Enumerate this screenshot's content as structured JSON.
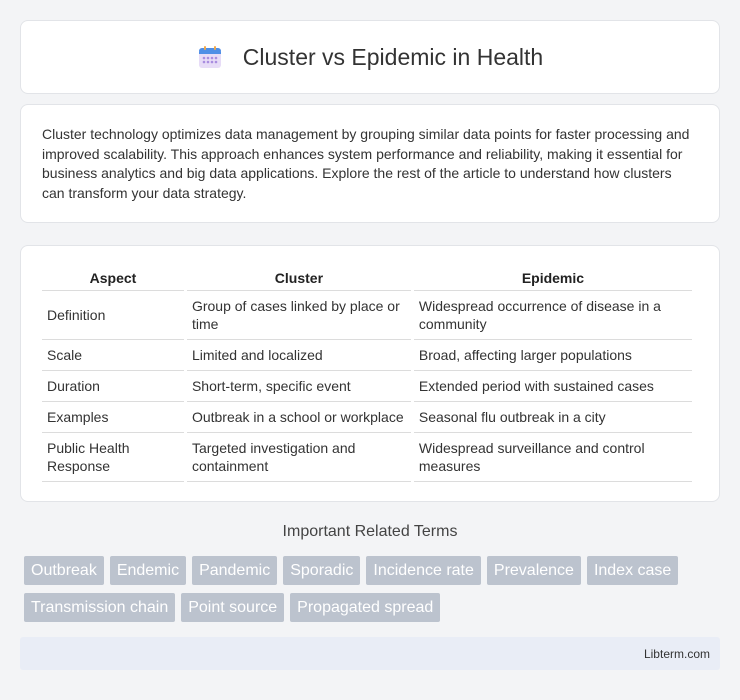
{
  "header": {
    "title": "Cluster vs Epidemic in Health",
    "icon": "calendar-icon"
  },
  "intro": {
    "text": "Cluster technology optimizes data management by grouping similar data points for faster processing and improved scalability. This approach enhances system performance and reliability, making it essential for business analytics and big data applications. Explore the rest of the article to understand how clusters can transform your data strategy."
  },
  "table": {
    "headers": [
      "Aspect",
      "Cluster",
      "Epidemic"
    ],
    "rows": [
      [
        "Definition",
        "Group of cases linked by place or time",
        "Widespread occurrence of disease in a community"
      ],
      [
        "Scale",
        "Limited and localized",
        "Broad, affecting larger populations"
      ],
      [
        "Duration",
        "Short-term, specific event",
        "Extended period with sustained cases"
      ],
      [
        "Examples",
        "Outbreak in a school or workplace",
        "Seasonal flu outbreak in a city"
      ],
      [
        "Public Health Response",
        "Targeted investigation and containment",
        "Widespread surveillance and control measures"
      ]
    ]
  },
  "related": {
    "title": "Important Related Terms",
    "tags": [
      "Outbreak",
      "Endemic",
      "Pandemic",
      "Sporadic",
      "Incidence rate",
      "Prevalence",
      "Index case",
      "Transmission chain",
      "Point source",
      "Propagated spread"
    ]
  },
  "footer": {
    "site": "Libterm.com"
  },
  "colors": {
    "tag_bg": "#bcc3ce",
    "footer_bg": "#e9edf6",
    "page_bg": "#f3f4f6"
  }
}
